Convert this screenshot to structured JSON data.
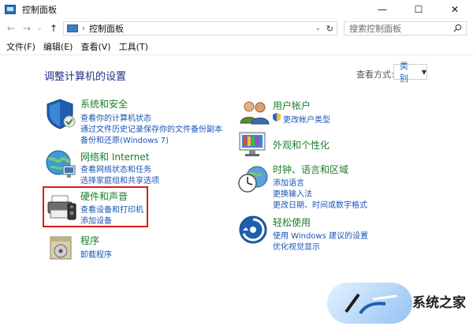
{
  "window": {
    "title": "控制面板",
    "buttons": {
      "minimize": "—",
      "maximize": "☐",
      "close": "✕"
    }
  },
  "nav": {
    "back": "←",
    "forward": "→",
    "recent": "⌄",
    "up": "↑",
    "breadcrumb": "控制面板",
    "search_placeholder": "搜索控制面板"
  },
  "menu": [
    "文件(F)",
    "编辑(E)",
    "查看(V)",
    "工具(T)"
  ],
  "main": {
    "heading": "调整计算机的设置",
    "view_by_label": "查看方式:",
    "view_by_value": "类别"
  },
  "categories_left": [
    {
      "title": "系统和安全",
      "links": [
        "查看你的计算机状态",
        "通过文件历史记录保存你的文件备份副本",
        "备份和还原(Windows 7)"
      ]
    },
    {
      "title": "网络和 Internet",
      "links": [
        "查看网络状态和任务",
        "选择家庭组和共享选项"
      ]
    },
    {
      "title": "硬件和声音",
      "links": [
        "查看设备和打印机",
        "添加设备"
      ]
    },
    {
      "title": "程序",
      "links": [
        "卸载程序"
      ]
    }
  ],
  "categories_right": [
    {
      "title": "用户帐户",
      "links": [
        "更改帐户类型"
      ]
    },
    {
      "title": "外观和个性化",
      "links": []
    },
    {
      "title": "时钟、语言和区域",
      "links": [
        "添加语言",
        "更换输入法",
        "更改日期、时间或数字格式"
      ]
    },
    {
      "title": "轻松使用",
      "links": [
        "使用 Windows 建议的设置",
        "优化视觉显示"
      ]
    }
  ],
  "watermark": {
    "text": "系统之家"
  },
  "colors": {
    "category_title": "#1a7d2b",
    "link": "#1a55b8",
    "heading": "#1e3287",
    "highlight": "#d31d1d"
  }
}
